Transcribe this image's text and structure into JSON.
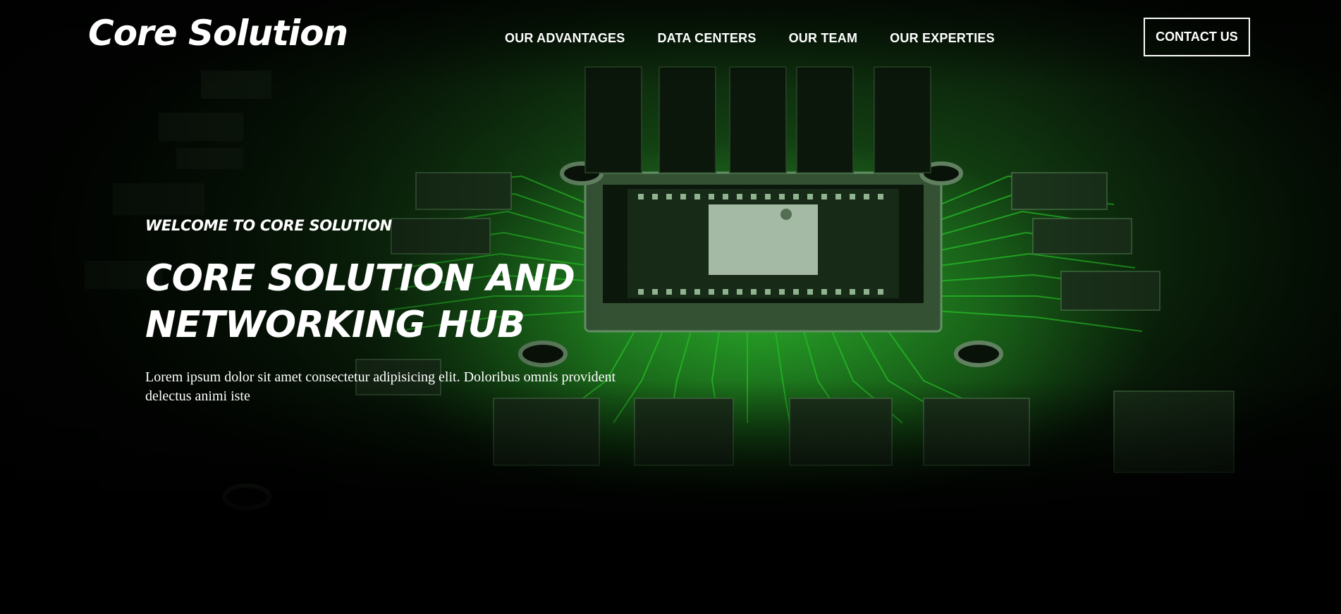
{
  "brand": {
    "name": "Core Solution"
  },
  "nav": {
    "items": [
      {
        "label": "OUR ADVANTAGES"
      },
      {
        "label": "DATA CENTERS"
      },
      {
        "label": "OUR TEAM"
      },
      {
        "label": "OUR EXPERTIES"
      }
    ],
    "cta_label": "CONTACT US"
  },
  "hero": {
    "eyebrow": "WELCOME TO CORE SOLUTION",
    "headline_line1": "CORE SOLUTION AND",
    "headline_line2": "NETWORKING HUB",
    "lead_line1": "Lorem ipsum dolor sit amet consectetur adipisicing elit. Doloribus omnis provident",
    "lead_line2": "delectus animi iste"
  },
  "colors": {
    "background": "#000000",
    "accent_green": "#2bd12b",
    "board_dark": "#0d240d",
    "text": "#ffffff"
  }
}
